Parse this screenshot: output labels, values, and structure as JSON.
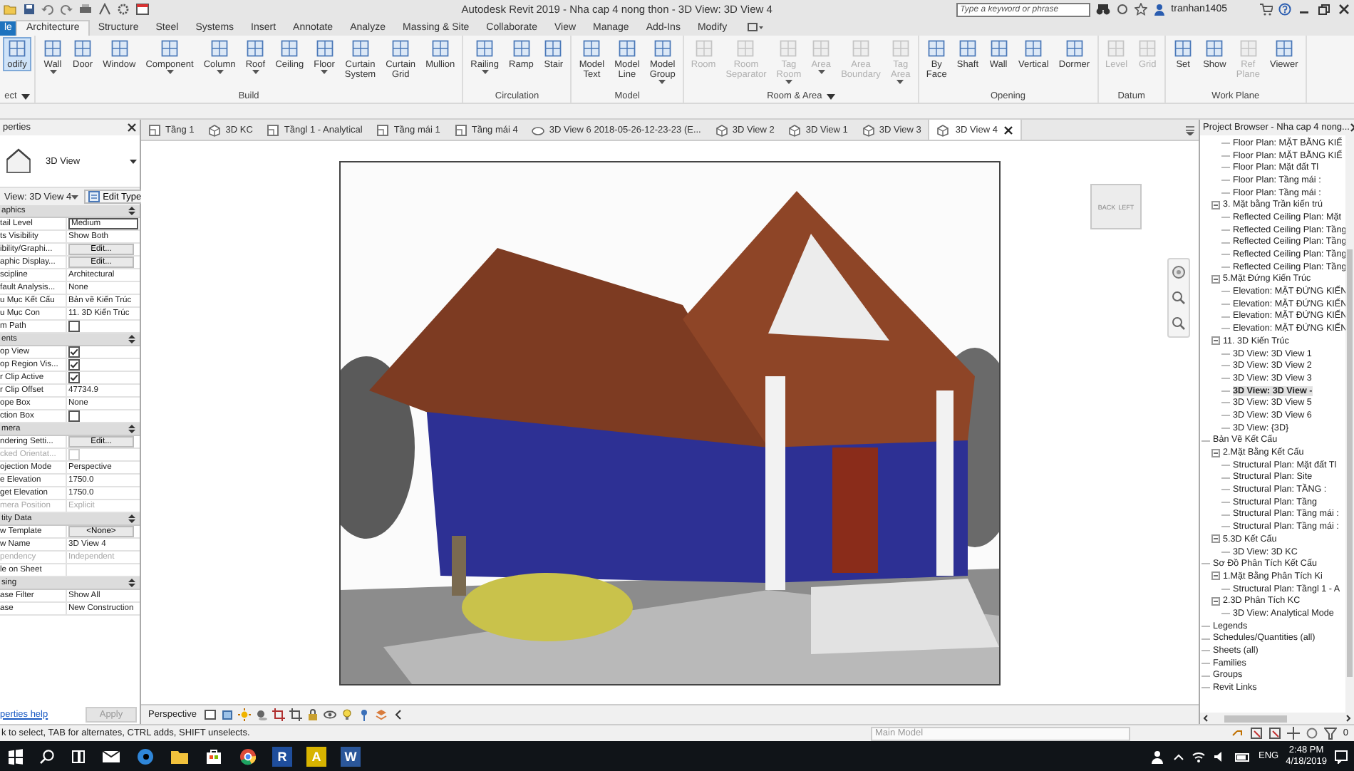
{
  "title_bar": {
    "title": "Autodesk Revit 2019 - Nha cap 4 nong thon - 3D View: 3D View 4",
    "search": {
      "placeholder": "Type a keyword or phrase"
    },
    "user": "tranhan1405"
  },
  "ribbon_tabs": [
    {
      "label": "le",
      "kind": "file",
      "selected": false
    },
    {
      "label": "Architecture",
      "kind": "tab",
      "selected": true
    },
    {
      "label": "Structure",
      "kind": "tab",
      "selected": false
    },
    {
      "label": "Steel",
      "kind": "tab",
      "selected": false
    },
    {
      "label": "Systems",
      "kind": "tab",
      "selected": false
    },
    {
      "label": "Insert",
      "kind": "tab",
      "selected": false
    },
    {
      "label": "Annotate",
      "kind": "tab",
      "selected": false
    },
    {
      "label": "Analyze",
      "kind": "tab",
      "selected": false
    },
    {
      "label": "Massing & Site",
      "kind": "tab",
      "selected": false
    },
    {
      "label": "Collaborate",
      "kind": "tab",
      "selected": false
    },
    {
      "label": "View",
      "kind": "tab",
      "selected": false
    },
    {
      "label": "Manage",
      "kind": "tab",
      "selected": false
    },
    {
      "label": "Add-Ins",
      "kind": "tab",
      "selected": false
    },
    {
      "label": "Modify",
      "kind": "tab",
      "selected": false
    }
  ],
  "ribbon_panels": [
    {
      "label": "ect",
      "dropdown": true,
      "tools": [
        {
          "label": "odify",
          "selected": true,
          "disabled": false,
          "dropdown": false
        }
      ]
    },
    {
      "label": "Build",
      "dropdown": false,
      "tools": [
        {
          "label": "Wall",
          "selected": false,
          "disabled": false,
          "dropdown": true
        },
        {
          "label": "Door",
          "selected": false,
          "disabled": false,
          "dropdown": false
        },
        {
          "label": "Window",
          "selected": false,
          "disabled": false,
          "dropdown": false
        },
        {
          "label": "Component",
          "selected": false,
          "disabled": false,
          "dropdown": true
        },
        {
          "label": "Column",
          "selected": false,
          "disabled": false,
          "dropdown": true
        },
        {
          "label": "Roof",
          "selected": false,
          "disabled": false,
          "dropdown": true
        },
        {
          "label": "Ceiling",
          "selected": false,
          "disabled": false,
          "dropdown": false
        },
        {
          "label": "Floor",
          "selected": false,
          "disabled": false,
          "dropdown": true
        },
        {
          "label": "Curtain System",
          "selected": false,
          "disabled": false,
          "dropdown": false
        },
        {
          "label": "Curtain Grid",
          "selected": false,
          "disabled": false,
          "dropdown": false
        },
        {
          "label": "Mullion",
          "selected": false,
          "disabled": false,
          "dropdown": false
        }
      ]
    },
    {
      "label": "Circulation",
      "dropdown": false,
      "tools": [
        {
          "label": "Railing",
          "selected": false,
          "disabled": false,
          "dropdown": true
        },
        {
          "label": "Ramp",
          "selected": false,
          "disabled": false,
          "dropdown": false
        },
        {
          "label": "Stair",
          "selected": false,
          "disabled": false,
          "dropdown": false
        }
      ]
    },
    {
      "label": "Model",
      "dropdown": false,
      "tools": [
        {
          "label": "Model Text",
          "selected": false,
          "disabled": false,
          "dropdown": false
        },
        {
          "label": "Model Line",
          "selected": false,
          "disabled": false,
          "dropdown": false
        },
        {
          "label": "Model Group",
          "selected": false,
          "disabled": false,
          "dropdown": true
        }
      ]
    },
    {
      "label": "Room & Area",
      "dropdown": true,
      "tools": [
        {
          "label": "Room",
          "selected": false,
          "disabled": true,
          "dropdown": false
        },
        {
          "label": "Room Separator",
          "selected": false,
          "disabled": true,
          "dropdown": false
        },
        {
          "label": "Tag Room",
          "selected": false,
          "disabled": true,
          "dropdown": true
        },
        {
          "label": "Area",
          "selected": false,
          "disabled": true,
          "dropdown": true
        },
        {
          "label": "Area Boundary",
          "selected": false,
          "disabled": true,
          "dropdown": false
        },
        {
          "label": "Tag Area",
          "selected": false,
          "disabled": true,
          "dropdown": true
        }
      ]
    },
    {
      "label": "Opening",
      "dropdown": false,
      "tools": [
        {
          "label": "By Face",
          "selected": false,
          "disabled": false,
          "dropdown": false
        },
        {
          "label": "Shaft",
          "selected": false,
          "disabled": false,
          "dropdown": false
        },
        {
          "label": "Wall",
          "selected": false,
          "disabled": false,
          "dropdown": false
        },
        {
          "label": "Vertical",
          "selected": false,
          "disabled": false,
          "dropdown": false
        },
        {
          "label": "Dormer",
          "selected": false,
          "disabled": false,
          "dropdown": false
        }
      ]
    },
    {
      "label": "Datum",
      "dropdown": false,
      "tools": [
        {
          "label": "Level",
          "selected": false,
          "disabled": true,
          "dropdown": false
        },
        {
          "label": "Grid",
          "selected": false,
          "disabled": true,
          "dropdown": false
        }
      ]
    },
    {
      "label": "Work Plane",
      "dropdown": false,
      "tools": [
        {
          "label": "Set",
          "selected": false,
          "disabled": false,
          "dropdown": false
        },
        {
          "label": "Show",
          "selected": false,
          "disabled": false,
          "dropdown": false
        },
        {
          "label": "Ref Plane",
          "selected": false,
          "disabled": true,
          "dropdown": false
        },
        {
          "label": "Viewer",
          "selected": false,
          "disabled": false,
          "dropdown": false
        }
      ]
    }
  ],
  "properties": {
    "title": "perties",
    "type_name": "3D View",
    "instance": "View: 3D View 4",
    "edit_type": "Edit Type",
    "groups": [
      {
        "label": "aphics",
        "rows": [
          {
            "label": "tail Level",
            "kind": "field",
            "value": "Medium",
            "disabled": false
          },
          {
            "label": "ts Visibility",
            "kind": "text",
            "value": "Show Both",
            "disabled": false
          },
          {
            "label": "ibility/Graphi...",
            "kind": "button",
            "value": "Edit...",
            "disabled": false
          },
          {
            "label": "aphic Display...",
            "kind": "button",
            "value": "Edit...",
            "disabled": false
          },
          {
            "label": "scipline",
            "kind": "text",
            "value": "Architectural",
            "disabled": false
          },
          {
            "label": "fault Analysis...",
            "kind": "text",
            "value": "None",
            "disabled": false
          },
          {
            "label": "u Mục Kết Cấu",
            "kind": "text",
            "value": "Bản vẽ Kiến Trúc",
            "disabled": false
          },
          {
            "label": "u Mục Con",
            "kind": "text",
            "value": "11. 3D Kiến Trúc",
            "disabled": false
          },
          {
            "label": "m Path",
            "kind": "check",
            "checked": false,
            "disabled": false
          }
        ]
      },
      {
        "label": "ents",
        "rows": [
          {
            "label": "op View",
            "kind": "check",
            "checked": true,
            "disabled": false
          },
          {
            "label": "op Region Vis...",
            "kind": "check",
            "checked": true,
            "disabled": false
          },
          {
            "label": "r Clip Active",
            "kind": "check",
            "checked": true,
            "disabled": false
          },
          {
            "label": "r Clip Offset",
            "kind": "text",
            "value": "47734.9",
            "disabled": false
          },
          {
            "label": "ope Box",
            "kind": "text",
            "value": "None",
            "disabled": false
          },
          {
            "label": "ction Box",
            "kind": "check",
            "checked": false,
            "disabled": false
          }
        ]
      },
      {
        "label": "mera",
        "rows": [
          {
            "label": "ndering Setti...",
            "kind": "button",
            "value": "Edit...",
            "disabled": false
          },
          {
            "label": "cked Orientat...",
            "kind": "check",
            "checked": false,
            "disabled": true
          },
          {
            "label": "ojection Mode",
            "kind": "text",
            "value": "Perspective",
            "disabled": false
          },
          {
            "label": "e Elevation",
            "kind": "text",
            "value": "1750.0",
            "disabled": false
          },
          {
            "label": "get Elevation",
            "kind": "text",
            "value": "1750.0",
            "disabled": false
          },
          {
            "label": "mera Position",
            "kind": "text",
            "value": "Explicit",
            "disabled": true
          }
        ]
      },
      {
        "label": "tity Data",
        "rows": [
          {
            "label": "w Template",
            "kind": "button",
            "value": "<None>",
            "disabled": false
          },
          {
            "label": "w Name",
            "kind": "text",
            "value": "3D View 4",
            "disabled": false
          },
          {
            "label": "pendency",
            "kind": "text",
            "value": "Independent",
            "disabled": true
          },
          {
            "label": "le on Sheet",
            "kind": "text",
            "disabled": false
          }
        ]
      },
      {
        "label": "sing",
        "rows": [
          {
            "label": "ase Filter",
            "kind": "text",
            "value": "Show All",
            "disabled": false
          },
          {
            "label": "ase",
            "kind": "text",
            "value": "New Construction",
            "disabled": false
          }
        ]
      }
    ],
    "help": "perties help",
    "apply": {
      "label": "Apply",
      "disabled": true
    }
  },
  "view_tabs": [
    {
      "label": "Tầng 1",
      "kind": "plan",
      "selected": false
    },
    {
      "label": "3D KC",
      "kind": "cube",
      "selected": false
    },
    {
      "label": "Tầngl 1 - Analytical",
      "kind": "plan",
      "selected": false
    },
    {
      "label": "Tầng mái 1",
      "kind": "plan",
      "selected": false
    },
    {
      "label": "Tầng mái 4",
      "kind": "plan",
      "selected": false
    },
    {
      "label": "3D View 6 2018-05-26-12-23-23 (E...",
      "kind": "camera",
      "selected": false
    },
    {
      "label": "3D View 2",
      "kind": "cube",
      "selected": false
    },
    {
      "label": "3D View 1",
      "kind": "cube",
      "selected": false
    },
    {
      "label": "3D View 3",
      "kind": "cube",
      "selected": false
    },
    {
      "label": "3D View 4",
      "kind": "cube",
      "selected": true
    }
  ],
  "view": {
    "view_cube": {
      "faces": [
        "BACK",
        "LEFT"
      ]
    },
    "control_bar": {
      "label": "Perspective"
    }
  },
  "project_browser": {
    "title": "Project Browser - Nha cap 4 nong...",
    "tree": [
      {
        "children": [
          {
            "children": [
              {
                "label": "Floor Plan: MẶT BẰNG KIẾ",
                "selected": false
              },
              {
                "label": "Floor Plan: MẶT BẰNG KIẾ",
                "selected": false
              },
              {
                "label": "Floor Plan: Mặt đất Tl",
                "selected": false
              },
              {
                "label": "Floor Plan: Tầng mái :",
                "selected": false
              },
              {
                "label": "Floor Plan: Tầng mái :",
                "selected": false
              }
            ]
          },
          {
            "label": "3. Mặt bằng Trần kiến trú",
            "expanded": true,
            "selected": false,
            "children": [
              {
                "label": "Reflected Ceiling Plan: Mặt",
                "selected": false
              },
              {
                "label": "Reflected Ceiling Plan: Tầng",
                "selected": false
              },
              {
                "label": "Reflected Ceiling Plan: Tầng",
                "selected": false
              },
              {
                "label": "Reflected Ceiling Plan: Tầng",
                "selected": false
              },
              {
                "label": "Reflected Ceiling Plan: Tầng",
                "selected": false
              }
            ]
          },
          {
            "label": "5.Mặt Đứng Kiến Trúc",
            "expanded": true,
            "selected": false,
            "children": [
              {
                "label": "Elevation: MẶT ĐỨNG KIẾN",
                "selected": false
              },
              {
                "label": "Elevation: MẶT ĐỨNG KIẾN",
                "selected": false
              },
              {
                "label": "Elevation: MẶT ĐỨNG KIẾN",
                "selected": false
              },
              {
                "label": "Elevation: MẶT ĐỨNG KIẾN",
                "selected": false
              }
            ]
          },
          {
            "label": "11. 3D Kiến Trúc",
            "expanded": true,
            "selected": false,
            "children": [
              {
                "label": "3D View: 3D View 1",
                "selected": false
              },
              {
                "label": "3D View: 3D View 2",
                "selected": false
              },
              {
                "label": "3D View: 3D View 3",
                "selected": false
              },
              {
                "label": "3D View: 3D View -",
                "selected": true
              },
              {
                "label": "3D View: 3D View 5",
                "selected": false
              },
              {
                "label": "3D View: 3D View 6",
                "selected": false
              },
              {
                "label": "3D View: {3D}",
                "selected": false
              }
            ]
          }
        ]
      },
      {
        "label": "Bản Vẽ Kết Cấu",
        "selected": false,
        "children": [
          {
            "label": "2.Mặt Bằng Kết Cấu",
            "expanded": true,
            "selected": false,
            "children": [
              {
                "label": "Structural Plan: Mặt đất Tl",
                "selected": false
              },
              {
                "label": "Structural Plan: Site",
                "selected": false
              },
              {
                "label": "Structural Plan: TẦNG :",
                "selected": false
              },
              {
                "label": "Structural Plan: Tầng",
                "selected": false
              },
              {
                "label": "Structural Plan: Tầng mái :",
                "selected": false
              },
              {
                "label": "Structural Plan: Tầng mái :",
                "selected": false
              }
            ]
          },
          {
            "label": "5.3D Kết Cấu",
            "expanded": true,
            "selected": false,
            "children": [
              {
                "label": "3D View: 3D KC",
                "selected": false
              }
            ]
          }
        ]
      },
      {
        "label": "Sơ Đồ Phân Tích Kết Cấu",
        "selected": false,
        "children": [
          {
            "label": "1.Mặt Bằng Phân Tích Ki",
            "expanded": true,
            "selected": false,
            "children": [
              {
                "label": "Structural Plan: Tầngl 1 - A",
                "selected": false
              }
            ]
          },
          {
            "label": "2.3D Phân Tích KC",
            "expanded": true,
            "selected": false,
            "children": [
              {
                "label": "3D View: Analytical Mode",
                "selected": false
              }
            ]
          }
        ]
      },
      {
        "label": "Legends",
        "selected": false
      },
      {
        "label": "Schedules/Quantities (all)",
        "selected": false
      },
      {
        "label": "Sheets (all)",
        "selected": false
      },
      {
        "label": "Families",
        "selected": false
      },
      {
        "label": "Groups",
        "selected": false
      },
      {
        "label": "Revit Links",
        "selected": false
      }
    ]
  },
  "status_bar": {
    "text": "k to select, TAB for alternates, CTRL adds, SHIFT unselects.",
    "model": "Main Model",
    "filter_count": "0"
  },
  "taskbar": {
    "apps": [
      {
        "kind": "mail"
      },
      {
        "kind": "edge"
      },
      {
        "kind": "folder"
      },
      {
        "kind": "store"
      },
      {
        "kind": "chrome"
      },
      {
        "kind": "letter",
        "label": "R",
        "color": "#1f4e9c"
      },
      {
        "kind": "letter",
        "label": "A",
        "color": "#d8b400"
      },
      {
        "kind": "letter",
        "label": "W",
        "color": "#2b579a"
      }
    ],
    "lang": "ENG",
    "time": "2:48 PM",
    "date": "4/18/2019"
  }
}
